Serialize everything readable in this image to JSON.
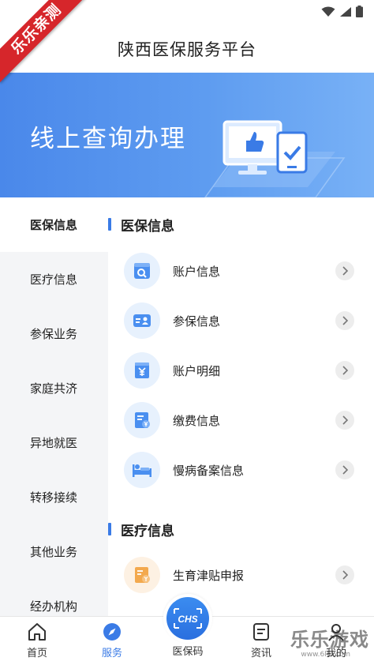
{
  "corner_badge": "乐乐亲测",
  "header": {
    "title": "陕西医保服务平台"
  },
  "banner": {
    "text": "线上查询办理"
  },
  "side_nav": {
    "items": [
      {
        "label": "医保信息"
      },
      {
        "label": "医疗信息"
      },
      {
        "label": "参保业务"
      },
      {
        "label": "家庭共济"
      },
      {
        "label": "异地就医"
      },
      {
        "label": "转移接续"
      },
      {
        "label": "其他业务"
      },
      {
        "label": "经办机构"
      }
    ]
  },
  "sections": [
    {
      "title": "医保信息",
      "rows": [
        {
          "label": "账户信息",
          "icon": "account-search-icon"
        },
        {
          "label": "参保信息",
          "icon": "insured-card-icon"
        },
        {
          "label": "账户明细",
          "icon": "yuan-document-icon"
        },
        {
          "label": "缴费信息",
          "icon": "payment-doc-icon"
        },
        {
          "label": "慢病备案信息",
          "icon": "patient-bed-icon"
        }
      ]
    },
    {
      "title": "医疗信息",
      "rows": [
        {
          "label": "生育津贴申报",
          "icon": "maternity-allowance-icon"
        }
      ]
    }
  ],
  "tab_bar": {
    "tabs": [
      {
        "label": "首页"
      },
      {
        "label": "服务"
      },
      {
        "label": "医保码"
      },
      {
        "label": "资讯"
      },
      {
        "label": "我的"
      }
    ]
  },
  "center_button": {
    "text": "CHS"
  },
  "watermark": {
    "text": "乐乐游戏",
    "url": "www.6l6l.com"
  },
  "colors": {
    "accent": "#3a7be6",
    "banner": "#4a88ea",
    "nav_bg": "#f4f5f7",
    "badge": "#d6262b"
  }
}
